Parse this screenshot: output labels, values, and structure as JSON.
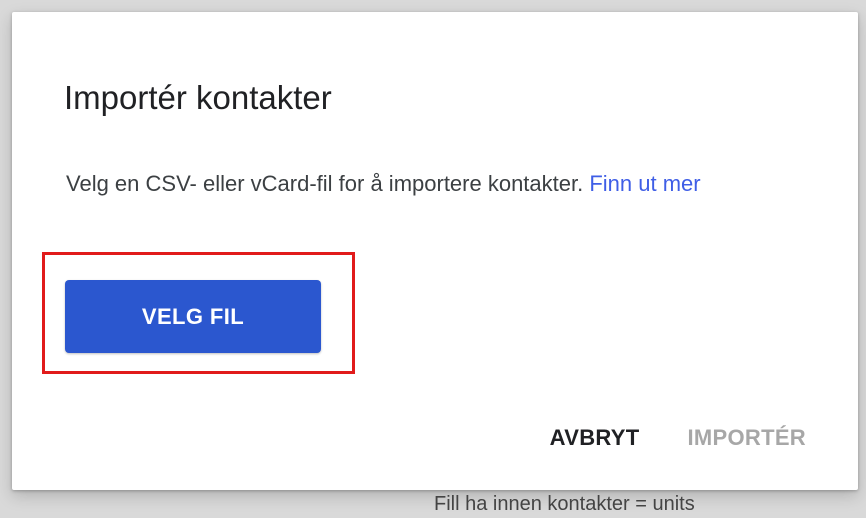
{
  "dialog": {
    "title": "Importér kontakter",
    "description": "Velg en CSV- eller vCard-fil for å importere kontakter.",
    "learn_more_link": "Finn ut mer",
    "select_file_button": "VELG FIL",
    "cancel_button": "AVBRYT",
    "import_button": "IMPORTÉR"
  },
  "background": {
    "partial_text": "Fill ha innen kontakter = units"
  },
  "colors": {
    "primary": "#2b57cf",
    "link": "#3f5ee6",
    "highlight_border": "#e11b1b",
    "disabled_text": "#a7a7a7"
  }
}
